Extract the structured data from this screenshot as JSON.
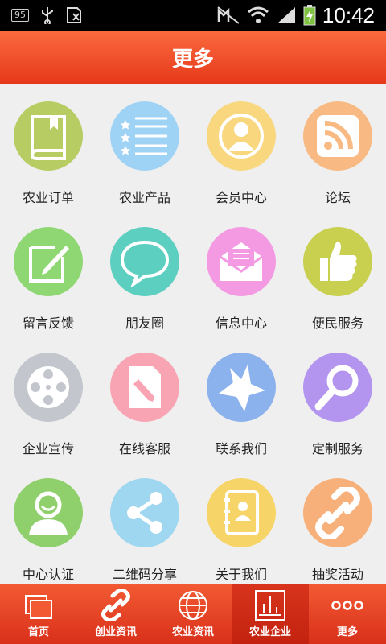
{
  "status_bar": {
    "badge": "95",
    "time": "10:42",
    "icons": [
      "usb-icon",
      "sd-card-icon",
      "no-sim-icon",
      "wifi-icon",
      "signal-icon",
      "battery-charging-icon"
    ]
  },
  "header": {
    "title": "更多"
  },
  "grid": {
    "items": [
      {
        "label": "农业订单",
        "icon": "book-icon",
        "color": "#b7cc63"
      },
      {
        "label": "农业产品",
        "icon": "star-list-icon",
        "color": "#9fd3f5"
      },
      {
        "label": "会员中心",
        "icon": "member-icon",
        "color": "#f9d77e"
      },
      {
        "label": "论坛",
        "icon": "rss-icon",
        "color": "#f8b982"
      },
      {
        "label": "留言反馈",
        "icon": "pencil-note-icon",
        "color": "#8fd773"
      },
      {
        "label": "朋友圈",
        "icon": "chat-bubble-icon",
        "color": "#5ccfc0"
      },
      {
        "label": "信息中心",
        "icon": "mail-icon",
        "color": "#f39ae3"
      },
      {
        "label": "便民服务",
        "icon": "thumbs-up-icon",
        "color": "#c9cf4f"
      },
      {
        "label": "企业宣传",
        "icon": "film-reel-icon",
        "color": "#c3c7cd"
      },
      {
        "label": "在线客服",
        "icon": "edit-document-icon",
        "color": "#f8a4b3"
      },
      {
        "label": "联系我们",
        "icon": "star-icon",
        "color": "#8cb2ed"
      },
      {
        "label": "定制服务",
        "icon": "magnifier-icon",
        "color": "#b394ef"
      },
      {
        "label": "中心认证",
        "icon": "user-icon",
        "color": "#8fd06c"
      },
      {
        "label": "二维码分享",
        "icon": "share-icon",
        "color": "#9fd7f1"
      },
      {
        "label": "关于我们",
        "icon": "contacts-book-icon",
        "color": "#f7d468"
      },
      {
        "label": "抽奖活动",
        "icon": "link-icon",
        "color": "#f8b07a"
      }
    ]
  },
  "tabbar": {
    "tabs": [
      {
        "label": "首页",
        "icon": "layers-icon"
      },
      {
        "label": "创业资讯",
        "icon": "chain-icon"
      },
      {
        "label": "农业资讯",
        "icon": "globe-icon"
      },
      {
        "label": "农业企业",
        "icon": "bar-chart-icon"
      },
      {
        "label": "更多",
        "icon": "more-dots-icon"
      }
    ],
    "active_color": "#c2220f"
  }
}
